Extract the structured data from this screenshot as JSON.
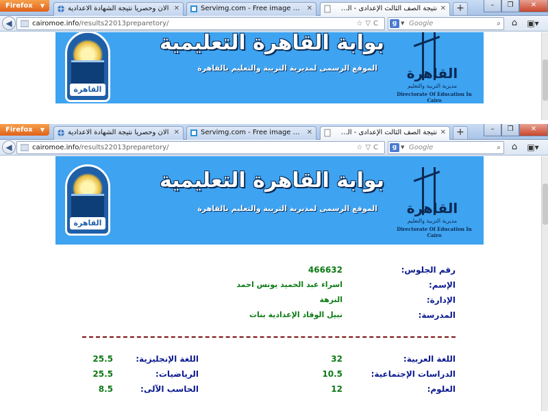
{
  "browser": {
    "app_button": "Firefox",
    "tabs": [
      {
        "label": "الان وحصريا نتيجة الشهادة الاعدادية"
      },
      {
        "label": "Servimg.com - Free image hosting se..."
      },
      {
        "label": "نتيجة الصف الثالث الإعدادى - الف..."
      }
    ],
    "new_tab": "+",
    "window_controls": {
      "minimize": "–",
      "restore": "❐",
      "close": "✕"
    },
    "url_host": "cairomoe.info",
    "url_path": "/results22013preparetory/",
    "search_engine_letter": "g",
    "search_placeholder": "Google"
  },
  "banner": {
    "title": "بوابة القاهرة التعليمية",
    "subtitle": "الموقع الرسمى لمديرية التربية والتعليم بالقاهرة",
    "left_logo_text": "القاهرة",
    "right_logo_text": "القاهرة",
    "right_logo_sub": "مديرية التربية والتعليم",
    "right_logo_en": "Directorate Of Education In Cairo"
  },
  "student": {
    "seat_label": "رقم الجلوس:",
    "seat_value": "466632",
    "name_label": "الإسم:",
    "name_value": "اسراء عبد الحميد يونس احمد",
    "admin_label": "الإدارة:",
    "admin_value": "النزهة",
    "school_label": "المدرسة:",
    "school_value": "نبيل الوقاد الإعدادية بنات"
  },
  "grades": {
    "right": [
      {
        "label": "اللغة العربية:",
        "value": "32"
      },
      {
        "label": "الدراسات الإجتماعية:",
        "value": "10.5"
      },
      {
        "label": "العلوم:",
        "value": "12"
      }
    ],
    "left": [
      {
        "label": "اللغة الإنجليزية:",
        "value": "25.5"
      },
      {
        "label": "الرياضيات:",
        "value": "25.5"
      },
      {
        "label": "الحاسب الآلى:",
        "value": "8.5"
      }
    ]
  }
}
